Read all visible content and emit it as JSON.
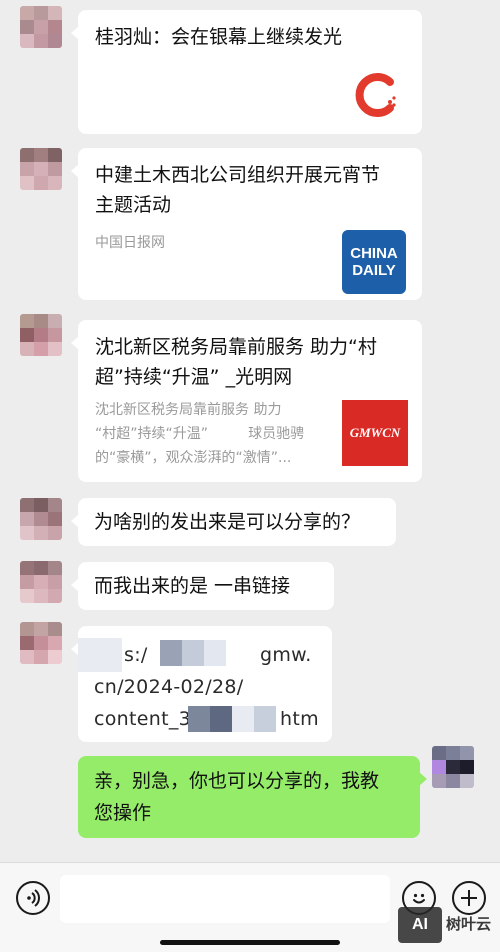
{
  "messages": {
    "m1": {
      "title": "桂羽灿：会在银幕上继续发光"
    },
    "m2": {
      "title_line1": "中建土木西北公司组织开展元宵节",
      "title_line2": "主题活动",
      "source": "中国日报网",
      "logo_line1": "CHINA",
      "logo_line2": "DAILY"
    },
    "m3": {
      "title_line1": "沈北新区税务局靠前服务 助力“村",
      "title_line2": "超”持续“升温” _光明网",
      "desc_line1": "沈北新区税务局靠前服务 助力",
      "desc_line2": "“村超”持续“升温”         球员驰骋",
      "desc_line3": "的“豪横”，观众澎湃的“激情”...",
      "logo_text": "GMWCN"
    },
    "m4": {
      "text": "为啥别的发出来是可以分享的？"
    },
    "m5": {
      "text": "而我出来的是 一串链接"
    },
    "m6": {
      "line1": "s:/",
      "line1_end": "gmw.",
      "line2": "cn/2024-02/28/",
      "line3_start": "content_3",
      "line3_end": "htm"
    },
    "m7": {
      "line1": "亲，别急，你也可以分享的，我教",
      "line2": "您操作"
    }
  },
  "watermark": {
    "ai_label": "AI",
    "site_label": "树叶云"
  },
  "colors": {
    "background": "#ededed",
    "bubble_white": "#ffffff",
    "bubble_green": "#95ec69",
    "china_daily_blue": "#1d5fa8",
    "gmw_red": "#d92a25"
  }
}
